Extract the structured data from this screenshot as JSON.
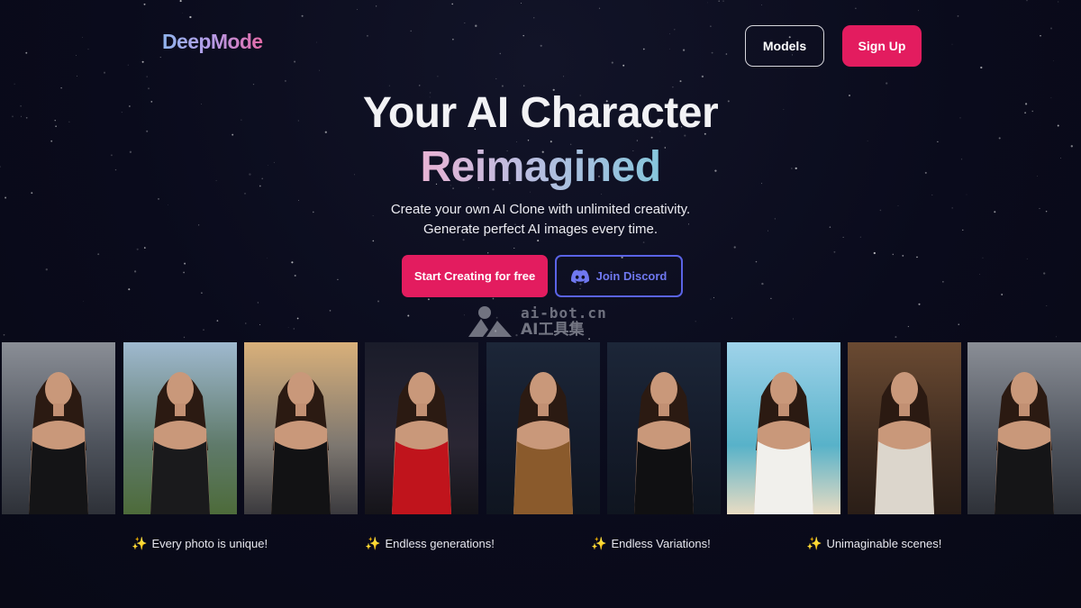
{
  "header": {
    "logo_text": "DeepMode",
    "models_label": "Models",
    "signup_label": "Sign Up"
  },
  "hero": {
    "title_line1": "Your AI Character",
    "title_line2": "Reimagined",
    "subtitle_line1": "Create your own AI Clone with unlimited creativity.",
    "subtitle_line2": "Generate perfect AI images every time.",
    "cta_primary": "Start Creating for free",
    "cta_secondary": "Join Discord"
  },
  "watermark": {
    "url": "ai-bot.cn",
    "name": "AI工具集"
  },
  "gallery": {
    "photos": [
      {
        "scene": "city-street",
        "outfit": "black jacket"
      },
      {
        "scene": "mountain-lake",
        "outfit": "black bikini"
      },
      {
        "scene": "city-rooftop",
        "outfit": "black dress"
      },
      {
        "scene": "red-carpet-night",
        "outfit": "red dress"
      },
      {
        "scene": "dark-studio",
        "outfit": "leopard top"
      },
      {
        "scene": "dark-studio",
        "outfit": "black cutout top"
      },
      {
        "scene": "beach",
        "outfit": "white bikini"
      },
      {
        "scene": "warm-room",
        "outfit": "white tank top"
      },
      {
        "scene": "city-street",
        "outfit": "black bikini top"
      }
    ]
  },
  "features": [
    "Every photo is unique!",
    "Endless generations!",
    "Endless Variations!",
    "Unimaginable scenes!"
  ],
  "colors": {
    "background": "#0a0b1c",
    "accent_pink": "#e31c5f",
    "discord_blue": "#5a63e6",
    "sparkle_icon": "#f3c93e"
  },
  "icons": {
    "discord": "discord-icon",
    "sparkles": "sparkles-icon",
    "watermark": "ai-bot-logo-icon"
  }
}
